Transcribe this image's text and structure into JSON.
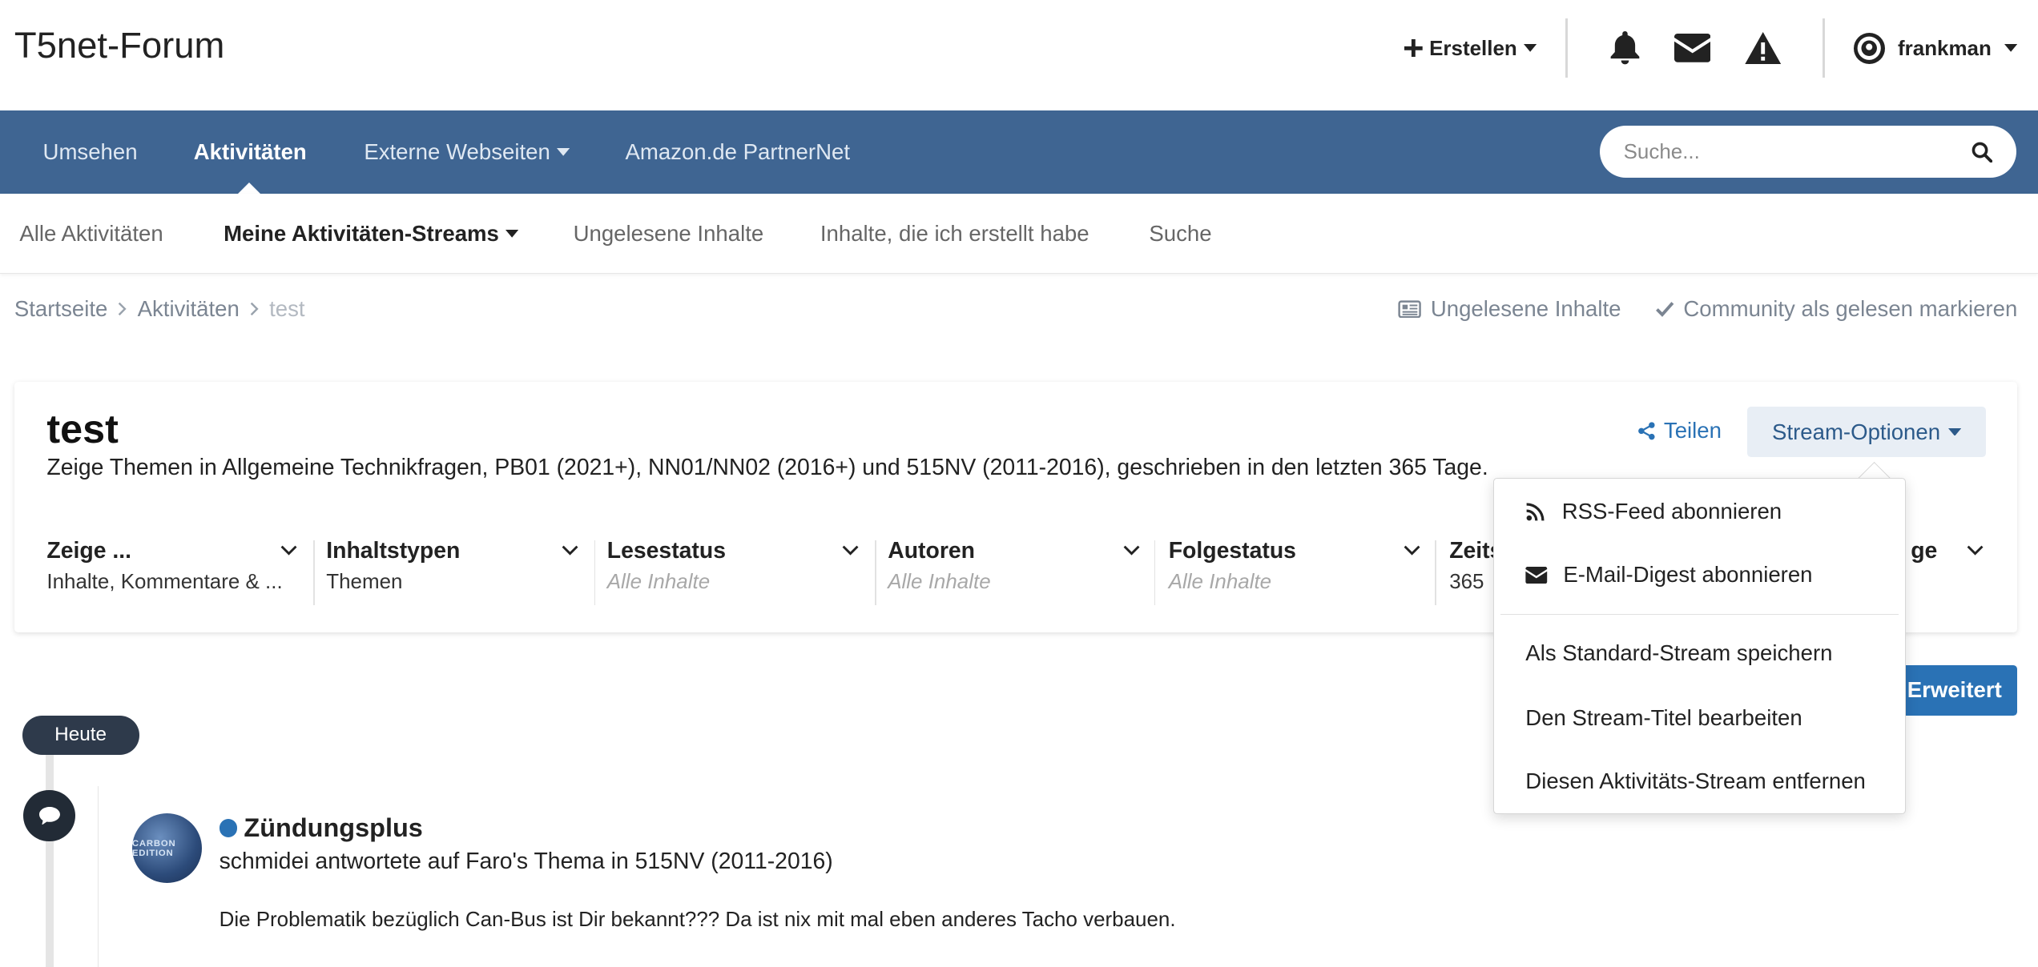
{
  "header": {
    "logo": "T5net-Forum",
    "create_label": "Erstellen",
    "username": "frankman"
  },
  "nav": {
    "items": [
      {
        "label": "Umsehen"
      },
      {
        "label": "Aktivitäten"
      },
      {
        "label": "Externe Webseiten"
      },
      {
        "label": "Amazon.de PartnerNet"
      }
    ],
    "search_placeholder": "Suche..."
  },
  "subnav": {
    "items": [
      {
        "label": "Alle Aktivitäten"
      },
      {
        "label": "Meine Aktivitäten-Streams"
      },
      {
        "label": "Ungelesene Inhalte"
      },
      {
        "label": "Inhalte, die ich erstellt habe"
      },
      {
        "label": "Suche"
      }
    ]
  },
  "breadcrumb": {
    "items": [
      "Startseite",
      "Aktivitäten",
      "test"
    ],
    "unread_label": "Ungelesene Inhalte",
    "mark_read_label": "Community als gelesen markieren"
  },
  "stream": {
    "title": "test",
    "description": "Zeige Themen in Allgemeine Technikfragen, PB01 (2021+), NN01/NN02 (2016+) und 515NV (2011-2016), geschrieben in den letzten 365 Tage.",
    "share_label": "Teilen",
    "options_label": "Stream-Optionen",
    "filters": [
      {
        "title": "Zeige ...",
        "value": "Inhalte, Kommentare & ..."
      },
      {
        "title": "Inhaltstypen",
        "value": "Themen"
      },
      {
        "title": "Lesestatus",
        "value": "Alle Inhalte"
      },
      {
        "title": "Autoren",
        "value": "Alle Inhalte"
      },
      {
        "title": "Folgestatus",
        "value": "Alle Inhalte"
      },
      {
        "title": "Zeits",
        "value": "365"
      },
      {
        "title": "ge",
        "value": ""
      }
    ],
    "advanced_label": "Erweitert"
  },
  "dropdown": {
    "items": [
      {
        "label": "RSS-Feed abonnieren",
        "icon": "rss-icon"
      },
      {
        "label": "E-Mail-Digest abonnieren",
        "icon": "envelope-icon"
      },
      {
        "label": "Als Standard-Stream speichern"
      },
      {
        "label": "Den Stream-Titel bearbeiten"
      },
      {
        "label": "Diesen Aktivitäts-Stream entfernen"
      }
    ]
  },
  "timeline": {
    "today_label": "Heute",
    "entry": {
      "title": "Zündungsplus",
      "meta": "schmidei antwortete auf Faro's Thema in 515NV (2011-2016)",
      "body": "Die Problematik bezüglich Can-Bus ist Dir bekannt??? Da ist nix mit mal eben anderes Tacho verbauen.",
      "avatar_text": "CARBON EDITION"
    }
  },
  "colors": {
    "nav_bg": "#3f6592",
    "accent": "#2a72b5",
    "today_badge": "#2e3a4b"
  }
}
